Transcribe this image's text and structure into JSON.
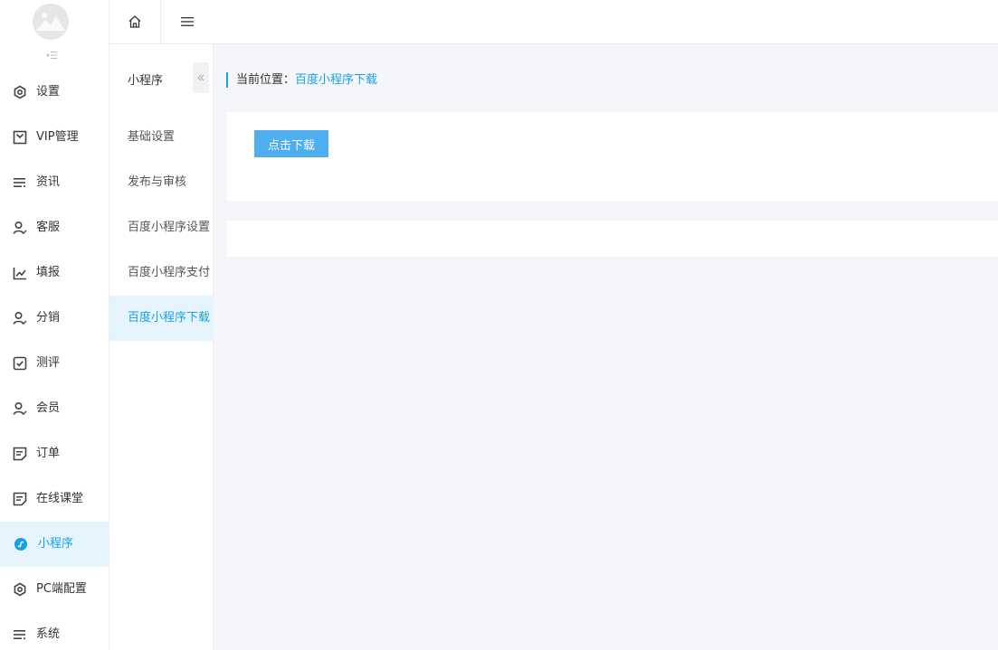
{
  "sidebar": {
    "items": [
      {
        "label": "设置",
        "icon": "settings-icon"
      },
      {
        "label": "VIP管理",
        "icon": "vip-icon"
      },
      {
        "label": "资讯",
        "icon": "list-icon"
      },
      {
        "label": "客服",
        "icon": "user-check-icon"
      },
      {
        "label": "填报",
        "icon": "chart-line-icon"
      },
      {
        "label": "分销",
        "icon": "user-check-icon"
      },
      {
        "label": "测评",
        "icon": "checkbox-icon"
      },
      {
        "label": "会员",
        "icon": "user-check-icon"
      },
      {
        "label": "订单",
        "icon": "document-icon"
      },
      {
        "label": "在线课堂",
        "icon": "document-icon"
      },
      {
        "label": "小程序",
        "icon": "mini-program-icon",
        "active": true
      },
      {
        "label": "PC端配置",
        "icon": "settings-icon"
      },
      {
        "label": "系统",
        "icon": "list-icon"
      }
    ]
  },
  "subnav": {
    "title": "小程序",
    "items": [
      {
        "label": "基础设置"
      },
      {
        "label": "发布与审核"
      },
      {
        "label": "百度小程序设置"
      },
      {
        "label": "百度小程序支付"
      },
      {
        "label": "百度小程序下载",
        "active": true
      }
    ]
  },
  "breadcrumb": {
    "prefix": "当前位置：",
    "current": "百度小程序下载"
  },
  "main": {
    "download_button": "点击下载"
  },
  "colors": {
    "accent": "#1aa0e8",
    "button": "#4eaef0",
    "active_bg": "#e6f4fd"
  }
}
